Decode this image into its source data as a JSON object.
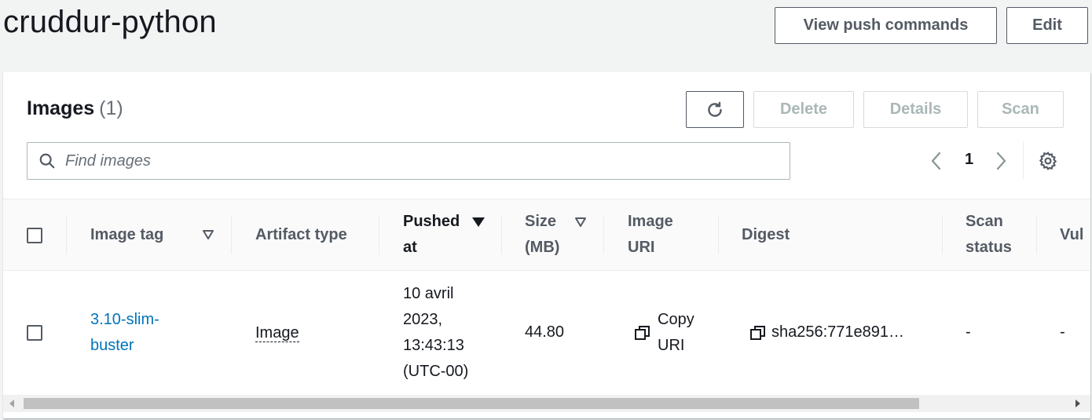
{
  "header": {
    "title": "cruddur-python",
    "view_push_label": "View push commands",
    "edit_label": "Edit"
  },
  "images_panel": {
    "heading": "Images",
    "count": "(1)",
    "delete_label": "Delete",
    "details_label": "Details",
    "scan_label": "Scan",
    "search_placeholder": "Find images",
    "page_number": "1"
  },
  "table": {
    "columns": {
      "image_tag": "Image tag",
      "artifact_type": "Artifact type",
      "pushed_at_line1": "Pushed",
      "pushed_at_line2": "at",
      "size_line1": "Size",
      "size_line2": "(MB)",
      "image_uri_line1": "Image",
      "image_uri_line2": "URI",
      "digest": "Digest",
      "scan_status_line1": "Scan",
      "scan_status_line2": "status",
      "vulnerabilities": "Vul"
    },
    "rows": [
      {
        "image_tag_line1": "3.10-slim-",
        "image_tag_line2": "buster",
        "artifact_type": "Image",
        "pushed_line1": "10 avril",
        "pushed_line2": "2023,",
        "pushed_line3": "13:43:13",
        "pushed_line4": "(UTC-00)",
        "size": "44.80",
        "copy_uri_line1": "Copy",
        "copy_uri_line2": "URI",
        "digest": "sha256:771e891…",
        "scan_status": "-",
        "vulnerabilities": "-"
      }
    ]
  },
  "colors": {
    "link": "#0073bb",
    "border": "#545b64",
    "disabled": "#aab7b8"
  },
  "icons": [
    "refresh-icon",
    "search-icon",
    "chevron-left-icon",
    "chevron-right-icon",
    "gear-icon",
    "sort-down-icon",
    "copy-icon"
  ]
}
